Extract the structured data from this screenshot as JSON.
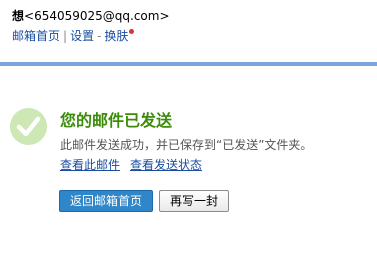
{
  "header": {
    "user_name": "想",
    "user_email": "<654059025@qq.com>",
    "nav": {
      "home": "邮箱首页",
      "sep": "|",
      "settings": "设置",
      "dash": "-",
      "skin": "换肤"
    }
  },
  "result": {
    "title": "您的邮件已发送",
    "description": "此邮件发送成功，并已保存到“已发送”文件夹。",
    "view_mail": "查看此邮件",
    "view_status": "查看发送状态"
  },
  "buttons": {
    "back_home": "返回邮箱首页",
    "write_another": "再写一封"
  },
  "colors": {
    "divider": "#7aa8da",
    "title": "#3c8c0a",
    "success_icon": "#cde7b5",
    "primary_button": "#2f86c8",
    "notification_dot": "#e03030"
  }
}
